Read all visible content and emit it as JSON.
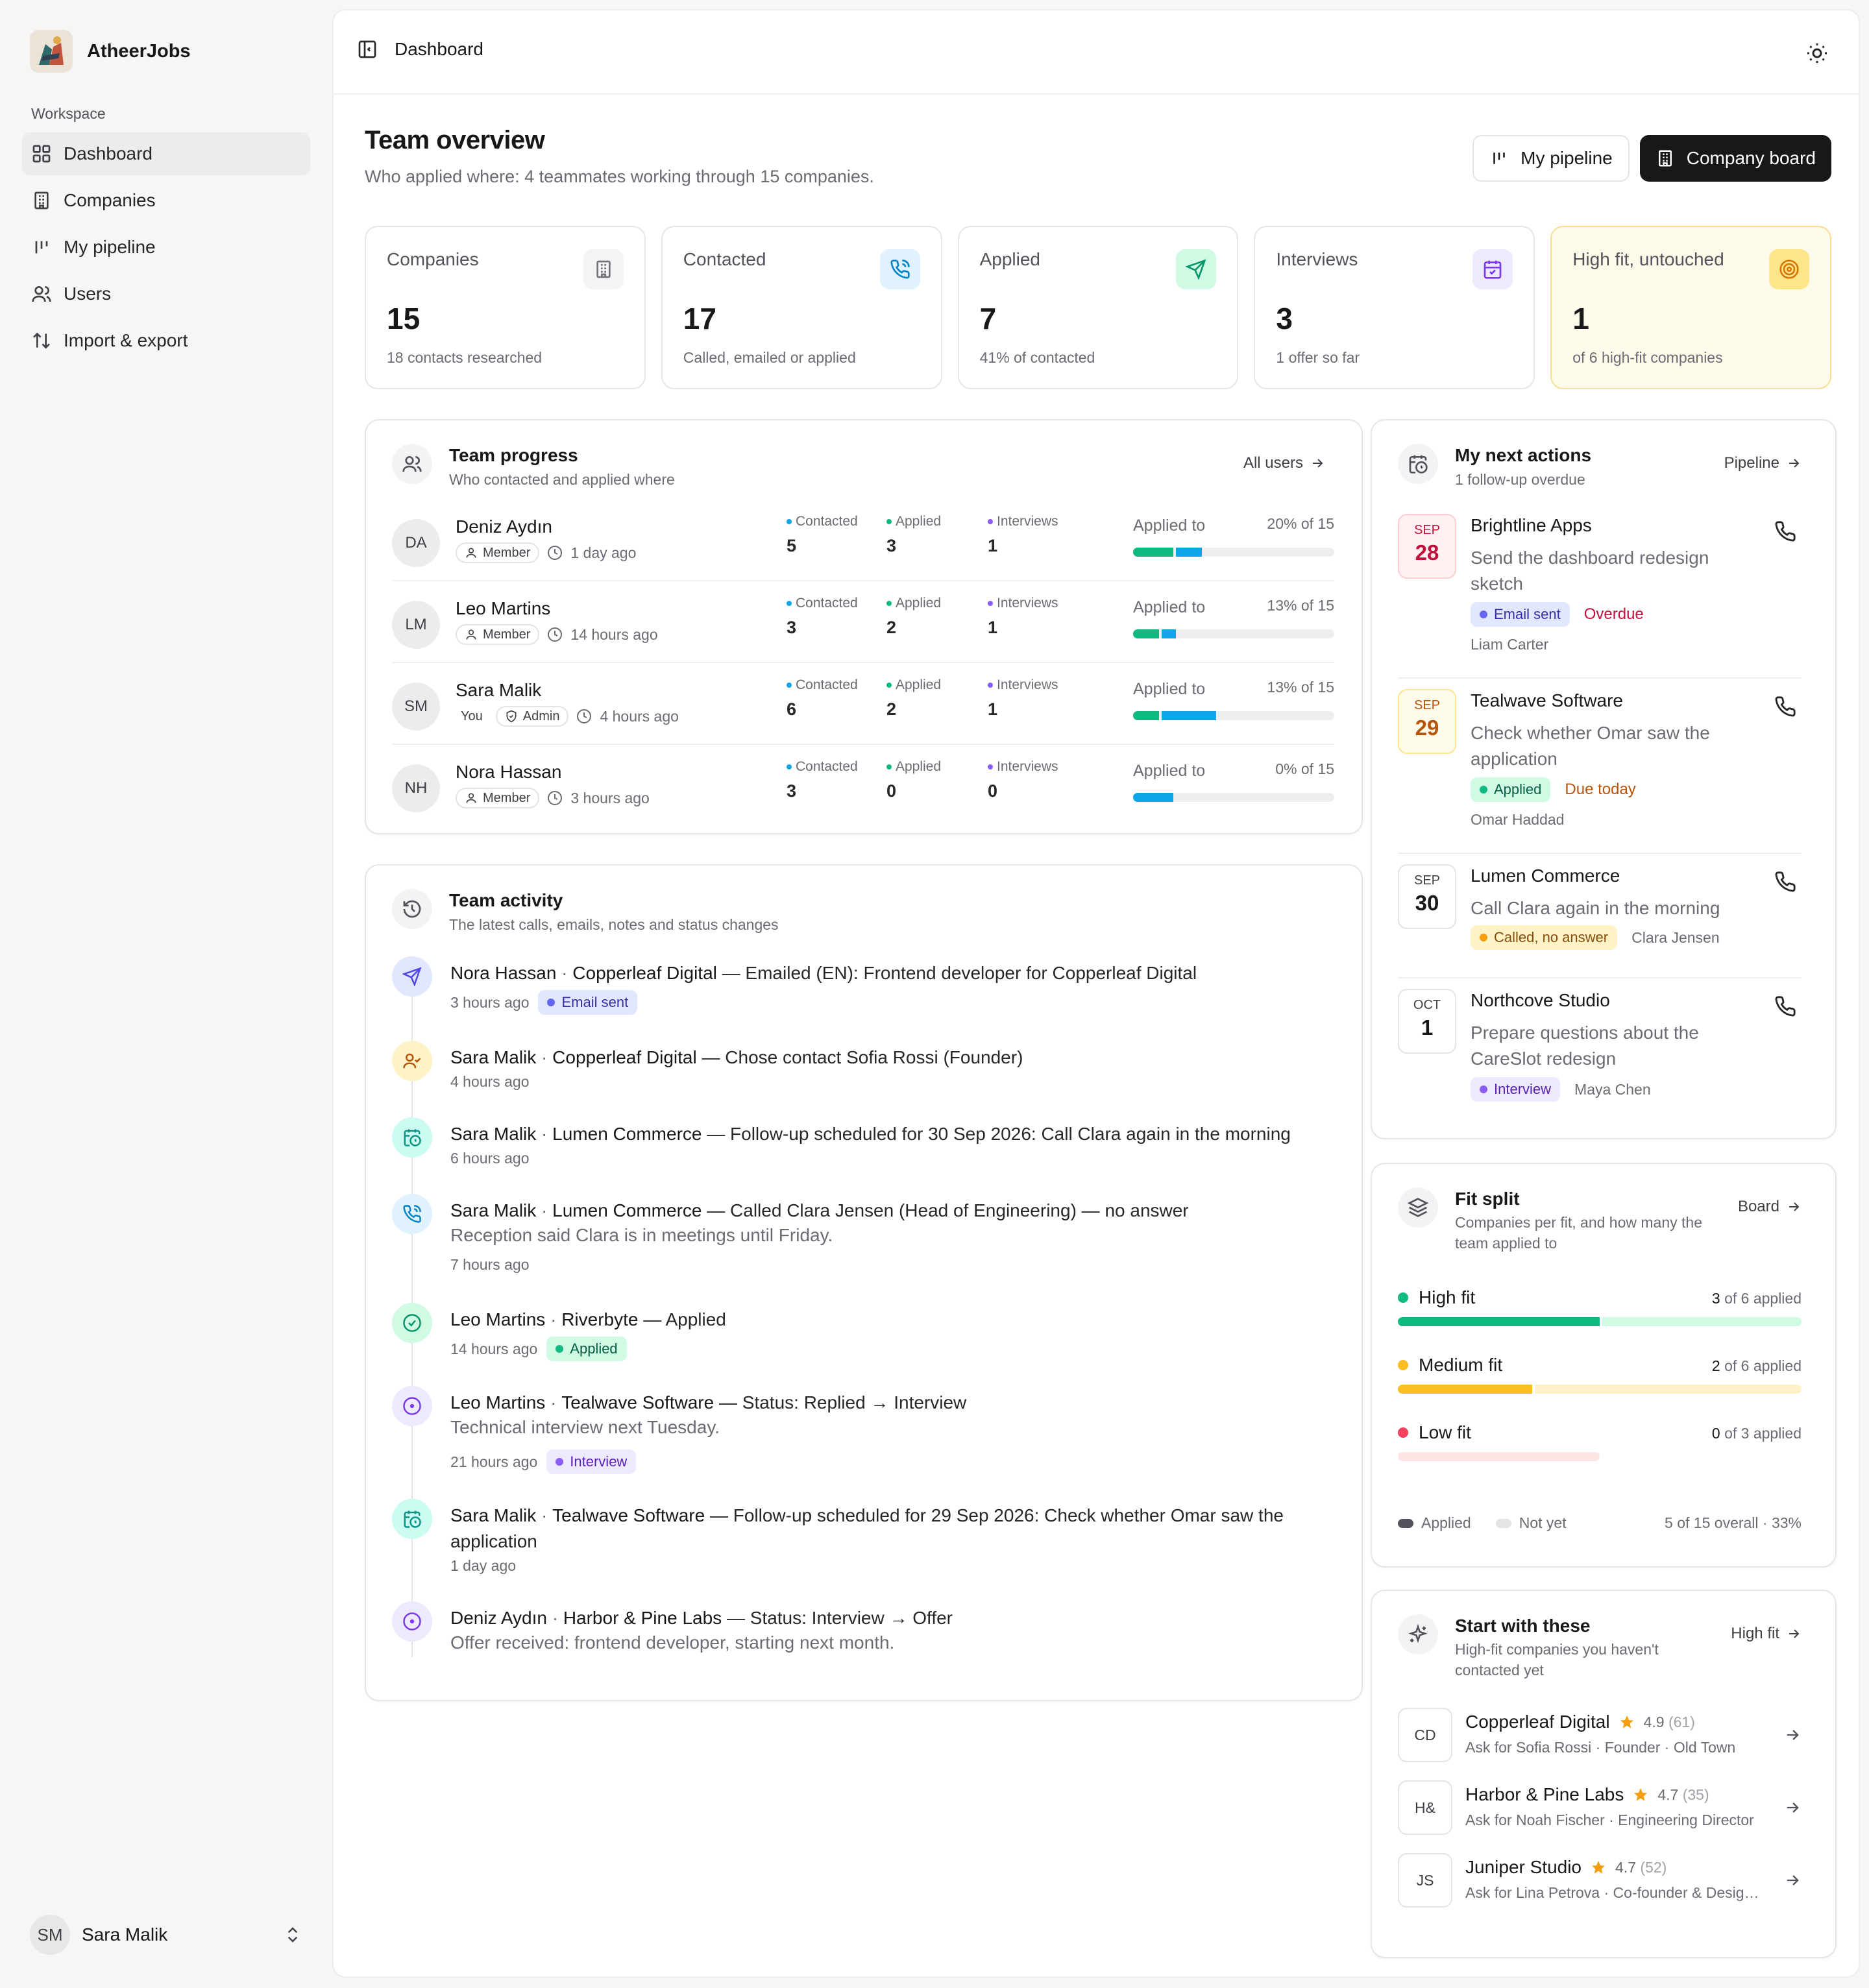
{
  "brand": {
    "name": "AtheerJobs"
  },
  "sidebar": {
    "section_label": "Workspace",
    "items": [
      {
        "label": "Dashboard",
        "icon": "grid-icon",
        "active": true
      },
      {
        "label": "Companies",
        "icon": "building-icon"
      },
      {
        "label": "My pipeline",
        "icon": "kanban-icon"
      },
      {
        "label": "Users",
        "icon": "users-icon"
      },
      {
        "label": "Import & export",
        "icon": "arrows-updown-icon"
      }
    ],
    "user": {
      "initials": "SM",
      "name": "Sara Malik"
    }
  },
  "topbar": {
    "breadcrumb": "Dashboard"
  },
  "header": {
    "title": "Team overview",
    "subtitle": "Who applied where: 4 teammates working through 15 companies.",
    "my_pipeline_label": "My pipeline",
    "company_board_label": "Company board"
  },
  "stats": [
    {
      "label": "Companies",
      "value": "15",
      "sub": "18 contacts researched",
      "icon": "building-icon",
      "icon_color": "#71717a",
      "icon_bg": "#f4f4f5"
    },
    {
      "label": "Contacted",
      "value": "17",
      "sub": "Called, emailed or applied",
      "icon": "phone-call-icon",
      "icon_color": "#0284c7",
      "icon_bg": "#e0f2fe"
    },
    {
      "label": "Applied",
      "value": "7",
      "sub": "41% of contacted",
      "icon": "send-icon",
      "icon_color": "#059669",
      "icon_bg": "#d1fae5"
    },
    {
      "label": "Interviews",
      "value": "3",
      "sub": "1 offer so far",
      "icon": "calendar-icon",
      "icon_color": "#7c3aed",
      "icon_bg": "#ede9fe"
    },
    {
      "label": "High fit, untouched",
      "value": "1",
      "sub": "of 6 high-fit companies",
      "icon": "target-icon",
      "icon_color": "#d97706",
      "icon_bg": "#fde68a"
    }
  ],
  "team_progress": {
    "title": "Team progress",
    "subtitle": "Who contacted and applied where",
    "link": "All users",
    "contacted_label": "Contacted",
    "applied_label": "Applied",
    "interviews_label": "Interviews",
    "applied_to_label": "Applied to",
    "rows": [
      {
        "initials": "DA",
        "name": "Deniz Aydın",
        "badges": [
          "Member"
        ],
        "last_seen": "1 day ago",
        "contacted": "5",
        "applied": "3",
        "interviews": "1",
        "pct_label": "20% of 15",
        "applied_frac": 0.2,
        "contacted_frac": 0.13
      },
      {
        "initials": "LM",
        "name": "Leo Martins",
        "badges": [
          "Member"
        ],
        "last_seen": "14 hours ago",
        "contacted": "3",
        "applied": "2",
        "interviews": "1",
        "pct_label": "13% of 15",
        "applied_frac": 0.13,
        "contacted_frac": 0.07
      },
      {
        "initials": "SM",
        "name": "Sara Malik",
        "you": "You",
        "badges": [
          "Admin"
        ],
        "last_seen": "4 hours ago",
        "contacted": "6",
        "applied": "2",
        "interviews": "1",
        "pct_label": "13% of 15",
        "applied_frac": 0.13,
        "contacted_frac": 0.27
      },
      {
        "initials": "NH",
        "name": "Nora Hassan",
        "badges": [
          "Member"
        ],
        "last_seen": "3 hours ago",
        "contacted": "3",
        "applied": "0",
        "interviews": "0",
        "pct_label": "0% of 15",
        "applied_frac": 0,
        "contacted_frac": 0.2
      }
    ]
  },
  "team_activity": {
    "title": "Team activity",
    "subtitle": "The latest calls, emails, notes and status changes",
    "events": [
      {
        "icon": "send-icon",
        "icon_color": "#4f46e5",
        "icon_bg": "#e0e7ff",
        "user": "Nora Hassan",
        "company": "Copperleaf Digital",
        "text": "— Emailed (EN): Frontend developer for Copperleaf Digital",
        "time": "3 hours ago",
        "tag": "Email sent",
        "tag_style": "blue"
      },
      {
        "icon": "user-check-icon",
        "icon_color": "#b45309",
        "icon_bg": "#fef3c7",
        "user": "Sara Malik",
        "company": "Copperleaf Digital",
        "text": "— Chose contact Sofia Rossi (Founder)",
        "time": "4 hours ago"
      },
      {
        "icon": "calendar-clock-icon",
        "icon_color": "#0d9488",
        "icon_bg": "#ccfbf1",
        "user": "Sara Malik",
        "company": "Lumen Commerce",
        "text": "— Follow-up scheduled for 30 Sep 2026: Call Clara again in the morning",
        "time": "6 hours ago"
      },
      {
        "icon": "phone-call-icon",
        "icon_color": "#0284c7",
        "icon_bg": "#e0f2fe",
        "user": "Sara Malik",
        "company": "Lumen Commerce",
        "text": "— Called Clara Jensen (Head of Engineering) — no answer",
        "note": "Reception said Clara is in meetings until Friday.",
        "time": "7 hours ago"
      },
      {
        "icon": "check-circle-icon",
        "icon_color": "#059669",
        "icon_bg": "#d1fae5",
        "user": "Leo Martins",
        "company": "Riverbyte",
        "text": "— Applied",
        "time": "14 hours ago",
        "tag": "Applied",
        "tag_style": "green"
      },
      {
        "icon": "circle-dot-icon",
        "icon_color": "#7c3aed",
        "icon_bg": "#ede9fe",
        "user": "Leo Martins",
        "company": "Tealwave Software",
        "text": "— Status: Replied → Interview",
        "note": "Technical interview next Tuesday.",
        "time": "21 hours ago",
        "tag": "Interview",
        "tag_style": "purple"
      },
      {
        "icon": "calendar-clock-icon",
        "icon_color": "#0d9488",
        "icon_bg": "#ccfbf1",
        "user": "Sara Malik",
        "company": "Tealwave Software",
        "text": "— Follow-up scheduled for 29 Sep 2026: Check whether Omar saw the application",
        "time": "1 day ago"
      },
      {
        "icon": "circle-dot-icon",
        "icon_color": "#7c3aed",
        "icon_bg": "#ede9fe",
        "user": "Deniz Aydın",
        "company": "Harbor & Pine Labs",
        "text": "— Status: Interview → Offer",
        "note": "Offer received: frontend developer, starting next month."
      }
    ]
  },
  "next_actions": {
    "title": "My next actions",
    "subtitle": "1 follow-up overdue",
    "link": "Pipeline",
    "items": [
      {
        "month": "SEP",
        "day": "28",
        "date_style": "red",
        "company": "Brightline Apps",
        "desc": "Send the dashboard redesign sketch",
        "tag": "Email sent",
        "tag_style": "blue",
        "status": "Overdue",
        "status_color": "#be123c",
        "contact": "Liam Carter"
      },
      {
        "month": "SEP",
        "day": "29",
        "date_style": "amber",
        "company": "Tealwave Software",
        "desc": "Check whether Omar saw the application",
        "tag": "Applied",
        "tag_style": "green",
        "status": "Due today",
        "status_color": "#b45309",
        "contact": "Omar Haddad"
      },
      {
        "month": "SEP",
        "day": "30",
        "date_style": "plain",
        "company": "Lumen Commerce",
        "desc": "Call Clara again in the morning",
        "tag": "Called, no answer",
        "tag_style": "yellow",
        "contact": "Clara Jensen"
      },
      {
        "month": "OCT",
        "day": "1",
        "date_style": "plain",
        "company": "Northcove Studio",
        "desc": "Prepare questions about the CareSlot redesign",
        "tag": "Interview",
        "tag_style": "purple",
        "contact": "Maya Chen"
      }
    ]
  },
  "fit_split": {
    "title": "Fit split",
    "subtitle": "Companies per fit, and how many the team applied to",
    "link": "Board",
    "rows": [
      {
        "name": "High fit",
        "applied": "3",
        "total_label": "of 6 applied",
        "applied_n": 3,
        "total_n": 6,
        "color": "#10b981",
        "light": "#d1fae5"
      },
      {
        "name": "Medium fit",
        "applied": "2",
        "total_label": "of 6 applied",
        "applied_n": 2,
        "total_n": 6,
        "color": "#fbbf24",
        "light": "#fef3c7"
      },
      {
        "name": "Low fit",
        "applied": "0",
        "total_label": "of 3 applied",
        "applied_n": 0,
        "total_n": 3,
        "color": "#f43f5e",
        "light": "#ffe4e6"
      }
    ],
    "legend_applied": "Applied",
    "legend_not_yet": "Not yet",
    "overall": "5 of 15 overall · 33%"
  },
  "start_with": {
    "title": "Start with these",
    "subtitle": "High-fit companies you haven't contacted yet",
    "link": "High fit",
    "items": [
      {
        "initials": "CD",
        "name": "Copperleaf Digital",
        "rating": "4.9",
        "reviews": "(61)",
        "sub": "Ask for Sofia Rossi · Founder · Old Town"
      },
      {
        "initials": "H&",
        "name": "Harbor & Pine Labs",
        "rating": "4.7",
        "reviews": "(35)",
        "sub": "Ask for Noah Fischer · Engineering Director"
      },
      {
        "initials": "JS",
        "name": "Juniper Studio",
        "rating": "4.7",
        "reviews": "(52)",
        "sub": "Ask for Lina Petrova · Co-founder & Design Lead"
      }
    ]
  }
}
